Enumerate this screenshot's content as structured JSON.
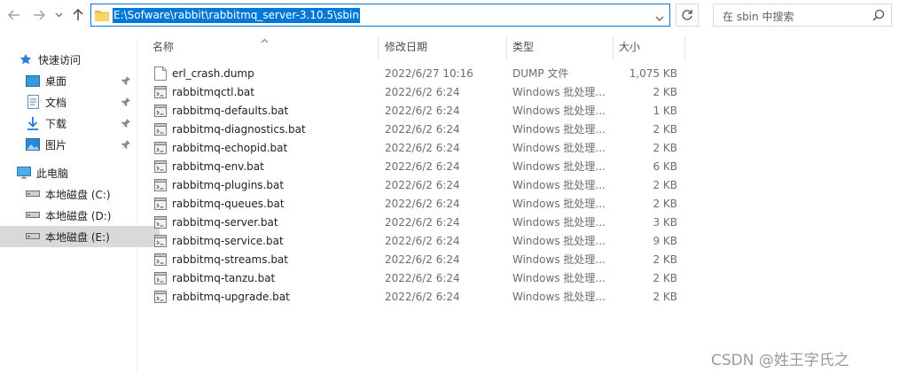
{
  "address": {
    "path": "E:\\Sofware\\rabbit\\rabbitmq_server-3.10.5\\sbin"
  },
  "search": {
    "placeholder": "在 sbin 中搜索"
  },
  "sidebar": {
    "quick_access": "快速访问",
    "items": [
      {
        "label": "桌面",
        "icon": "desktop-icon",
        "pinned": true
      },
      {
        "label": "文档",
        "icon": "documents-icon",
        "pinned": true
      },
      {
        "label": "下载",
        "icon": "download-icon",
        "pinned": true
      },
      {
        "label": "图片",
        "icon": "pictures-icon",
        "pinned": true
      }
    ],
    "this_pc": "此电脑",
    "drives": [
      {
        "label": "本地磁盘 (C:)",
        "selected": false
      },
      {
        "label": "本地磁盘 (D:)",
        "selected": false
      },
      {
        "label": "本地磁盘 (E:)",
        "selected": true
      }
    ]
  },
  "columns": {
    "name": "名称",
    "date": "修改日期",
    "type": "类型",
    "size": "大小"
  },
  "files": [
    {
      "name": "erl_crash.dump",
      "date": "2022/6/27 10:16",
      "type": "DUMP 文件",
      "size": "1,075 KB",
      "icon": "dump-file-icon"
    },
    {
      "name": "rabbitmqctl.bat",
      "date": "2022/6/2 6:24",
      "type": "Windows 批处理...",
      "size": "2 KB",
      "icon": "batch-file-icon"
    },
    {
      "name": "rabbitmq-defaults.bat",
      "date": "2022/6/2 6:24",
      "type": "Windows 批处理...",
      "size": "1 KB",
      "icon": "batch-file-icon"
    },
    {
      "name": "rabbitmq-diagnostics.bat",
      "date": "2022/6/2 6:24",
      "type": "Windows 批处理...",
      "size": "2 KB",
      "icon": "batch-file-icon"
    },
    {
      "name": "rabbitmq-echopid.bat",
      "date": "2022/6/2 6:24",
      "type": "Windows 批处理...",
      "size": "2 KB",
      "icon": "batch-file-icon"
    },
    {
      "name": "rabbitmq-env.bat",
      "date": "2022/6/2 6:24",
      "type": "Windows 批处理...",
      "size": "6 KB",
      "icon": "batch-file-icon"
    },
    {
      "name": "rabbitmq-plugins.bat",
      "date": "2022/6/2 6:24",
      "type": "Windows 批处理...",
      "size": "2 KB",
      "icon": "batch-file-icon"
    },
    {
      "name": "rabbitmq-queues.bat",
      "date": "2022/6/2 6:24",
      "type": "Windows 批处理...",
      "size": "2 KB",
      "icon": "batch-file-icon"
    },
    {
      "name": "rabbitmq-server.bat",
      "date": "2022/6/2 6:24",
      "type": "Windows 批处理...",
      "size": "3 KB",
      "icon": "batch-file-icon"
    },
    {
      "name": "rabbitmq-service.bat",
      "date": "2022/6/2 6:24",
      "type": "Windows 批处理...",
      "size": "9 KB",
      "icon": "batch-file-icon"
    },
    {
      "name": "rabbitmq-streams.bat",
      "date": "2022/6/2 6:24",
      "type": "Windows 批处理...",
      "size": "2 KB",
      "icon": "batch-file-icon"
    },
    {
      "name": "rabbitmq-tanzu.bat",
      "date": "2022/6/2 6:24",
      "type": "Windows 批处理...",
      "size": "2 KB",
      "icon": "batch-file-icon"
    },
    {
      "name": "rabbitmq-upgrade.bat",
      "date": "2022/6/2 6:24",
      "type": "Windows 批处理...",
      "size": "2 KB",
      "icon": "batch-file-icon"
    }
  ],
  "watermark": "CSDN @姓王字氏之",
  "colors": {
    "accent": "#0078d7",
    "selected_drive_bg": "#d9d9d9"
  }
}
